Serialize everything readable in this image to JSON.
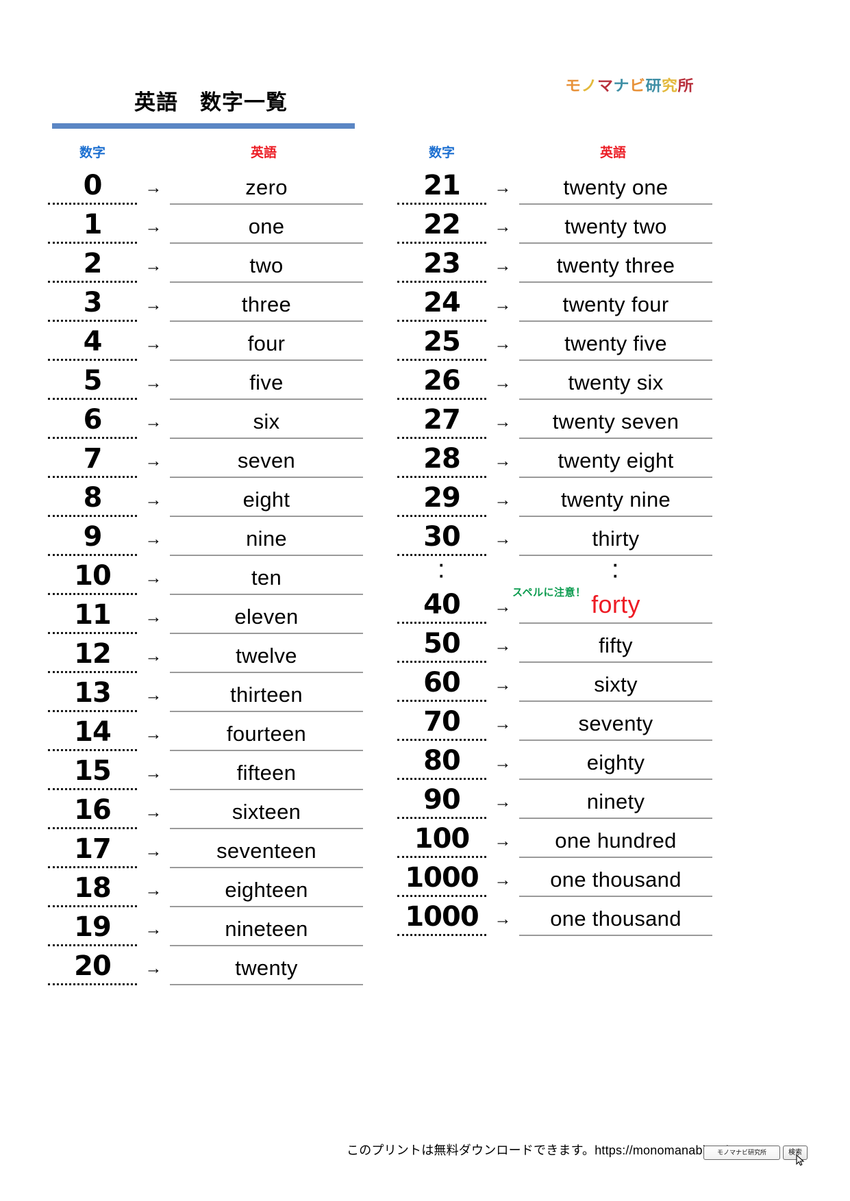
{
  "header": {
    "title": "英語　数字一覧",
    "brand": {
      "chars": [
        {
          "ch": "モ",
          "color": "#e8923a"
        },
        {
          "ch": "ノ",
          "color": "#e3b93c"
        },
        {
          "ch": "マ",
          "color": "#b8303c"
        },
        {
          "ch": "ナ",
          "color": "#3f8fa5"
        },
        {
          "ch": "ビ",
          "color": "#e8923a"
        },
        {
          "ch": "研",
          "color": "#3f8fa5"
        },
        {
          "ch": "究",
          "color": "#e3b93c"
        },
        {
          "ch": "所",
          "color": "#b8303c"
        }
      ]
    },
    "rule_color": "#5b86c4"
  },
  "columns": {
    "headers": {
      "number": "数字",
      "english": "英語",
      "number_color": "#1c6fd0",
      "english_color": "#ec1c24"
    },
    "arrow": "→",
    "left_rows": [
      {
        "num": "0",
        "eng": "zero"
      },
      {
        "num": "1",
        "eng": "one"
      },
      {
        "num": "2",
        "eng": "two"
      },
      {
        "num": "3",
        "eng": "three"
      },
      {
        "num": "4",
        "eng": "four"
      },
      {
        "num": "5",
        "eng": "five"
      },
      {
        "num": "6",
        "eng": "six"
      },
      {
        "num": "7",
        "eng": "seven"
      },
      {
        "num": "8",
        "eng": "eight"
      },
      {
        "num": "9",
        "eng": "nine"
      },
      {
        "num": "10",
        "eng": "ten"
      },
      {
        "num": "11",
        "eng": "eleven"
      },
      {
        "num": "12",
        "eng": "twelve"
      },
      {
        "num": "13",
        "eng": "thirteen"
      },
      {
        "num": "14",
        "eng": "fourteen"
      },
      {
        "num": "15",
        "eng": "fifteen"
      },
      {
        "num": "16",
        "eng": "sixteen"
      },
      {
        "num": "17",
        "eng": "seventeen"
      },
      {
        "num": "18",
        "eng": "eighteen"
      },
      {
        "num": "19",
        "eng": "nineteen"
      },
      {
        "num": "20",
        "eng": "twenty"
      }
    ],
    "right_rows": [
      {
        "num": "21",
        "eng": "twenty one"
      },
      {
        "num": "22",
        "eng": "twenty two"
      },
      {
        "num": "23",
        "eng": "twenty three"
      },
      {
        "num": "24",
        "eng": "twenty four"
      },
      {
        "num": "25",
        "eng": "twenty five"
      },
      {
        "num": "26",
        "eng": "twenty six"
      },
      {
        "num": "27",
        "eng": "twenty seven"
      },
      {
        "num": "28",
        "eng": "twenty eight"
      },
      {
        "num": "29",
        "eng": "twenty nine"
      },
      {
        "num": "30",
        "eng": "thirty"
      },
      {
        "num": "⋮",
        "eng": "⋮",
        "ellipsis": true
      },
      {
        "num": "40",
        "eng": "forty",
        "accent": true,
        "note": "スペルに注意！"
      },
      {
        "num": "50",
        "eng": "fifty"
      },
      {
        "num": "60",
        "eng": "sixty"
      },
      {
        "num": "70",
        "eng": "seventy"
      },
      {
        "num": "80",
        "eng": "eighty"
      },
      {
        "num": "90",
        "eng": "ninety"
      },
      {
        "num": "100",
        "eng": "one hundred"
      },
      {
        "num": "1000",
        "eng": "one thousand"
      },
      {
        "num": "1000",
        "eng": "one thousand"
      }
    ]
  },
  "footer": {
    "notice": "このプリントは無料ダウンロードできます。https://monomanabi.co.jp",
    "search_field_value": "モノマナビ研究所",
    "search_button_label": "検索"
  }
}
